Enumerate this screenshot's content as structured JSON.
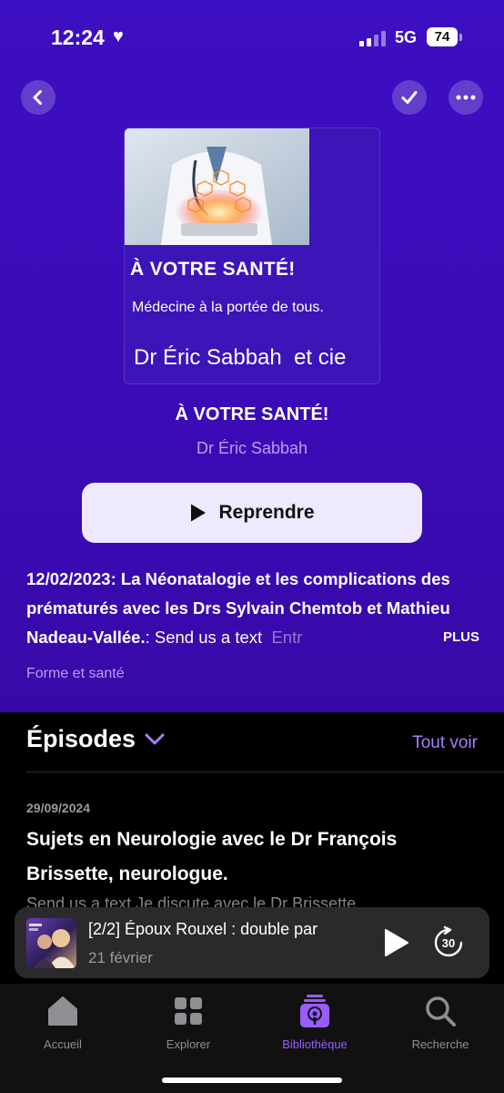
{
  "status_bar": {
    "time": "12:24",
    "network": "5G",
    "battery": "74"
  },
  "colors": {
    "hero_bg": "#3d0fc2",
    "accent": "#a87dff",
    "resume_bg": "#efe9ff"
  },
  "cover": {
    "title": "À VOTRE SANTÉ!",
    "subtitle": "Médecine à la portée de tous.",
    "author_line": "Dr Éric Sabbah  et cie"
  },
  "show": {
    "title": "À VOTRE SANTÉ!",
    "author": "Dr Éric Sabbah",
    "resume_label": "Reprendre",
    "description_bold": "12/02/2023: La Néonatalogie et les complications des prématurés avec les Drs Sylvain Chemtob et Mathieu Nadeau-Vallée.",
    "description_rest": ": Send us a text",
    "description_fade": "Entr",
    "more_label": "PLUS",
    "category": "Forme et santé"
  },
  "episodes": {
    "heading": "Épisodes",
    "see_all": "Tout voir",
    "items": [
      {
        "date": "29/09/2024",
        "title": "Sujets en Neurologie avec le Dr François Brissette, neurologue.",
        "snippet": "Send us a text   Je discute avec le Dr Brissette"
      }
    ]
  },
  "mini_player": {
    "title": "[2/2] Époux Rouxel : double par",
    "date": "21 février",
    "skip_seconds": "30"
  },
  "tabs": [
    {
      "label": "Accueil",
      "icon": "home-icon"
    },
    {
      "label": "Explorer",
      "icon": "grid-icon"
    },
    {
      "label": "Bibliothèque",
      "icon": "podcast-library-icon",
      "active": true
    },
    {
      "label": "Recherche",
      "icon": "search-icon"
    }
  ]
}
